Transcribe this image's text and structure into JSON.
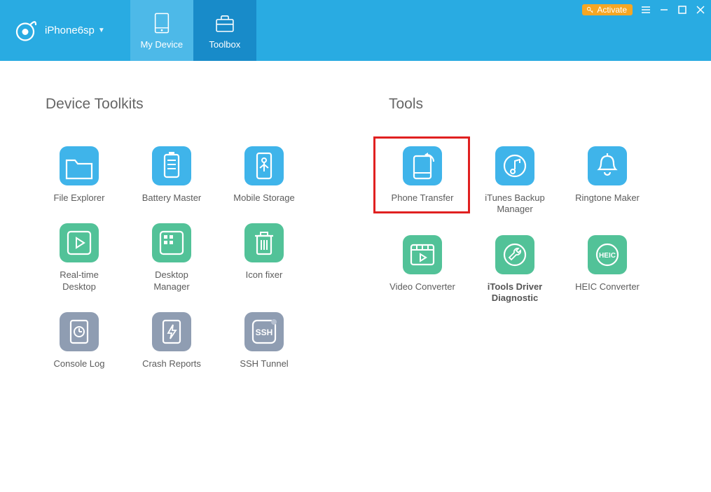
{
  "header": {
    "device_name": "iPhone6sp",
    "tabs": [
      {
        "label": "My Device"
      },
      {
        "label": "Toolbox"
      }
    ],
    "activate_label": "Activate"
  },
  "sections": {
    "left_title": "Device Toolkits",
    "right_title": "Tools"
  },
  "device_toolkits": [
    {
      "label": "File Explorer",
      "color": "blue",
      "icon": "folder-icon"
    },
    {
      "label": "Battery Master",
      "color": "blue",
      "icon": "battery-icon"
    },
    {
      "label": "Mobile Storage",
      "color": "blue",
      "icon": "usb-icon"
    },
    {
      "label": "Real-time Desktop",
      "color": "green",
      "icon": "play-icon"
    },
    {
      "label": "Desktop Manager",
      "color": "green",
      "icon": "grid-icon"
    },
    {
      "label": "Icon fixer",
      "color": "green",
      "icon": "trash-icon"
    },
    {
      "label": "Console Log",
      "color": "gray",
      "icon": "clock-doc-icon"
    },
    {
      "label": "Crash Reports",
      "color": "gray",
      "icon": "bolt-doc-icon"
    },
    {
      "label": "SSH Tunnel",
      "color": "gray",
      "icon": "ssh-icon"
    }
  ],
  "tools": [
    {
      "label": "Phone Transfer",
      "color": "blue",
      "icon": "phone-transfer-icon",
      "highlighted": true
    },
    {
      "label": "iTunes Backup Manager",
      "color": "blue",
      "icon": "music-doc-icon"
    },
    {
      "label": "Ringtone Maker",
      "color": "blue",
      "icon": "bell-icon"
    },
    {
      "label": "Video Converter",
      "color": "green",
      "icon": "film-icon"
    },
    {
      "label": "iTools Driver Diagnostic",
      "color": "green",
      "icon": "wrench-circle-icon",
      "bold": true
    },
    {
      "label": "HEIC Converter",
      "color": "green",
      "icon": "heic-icon"
    }
  ]
}
